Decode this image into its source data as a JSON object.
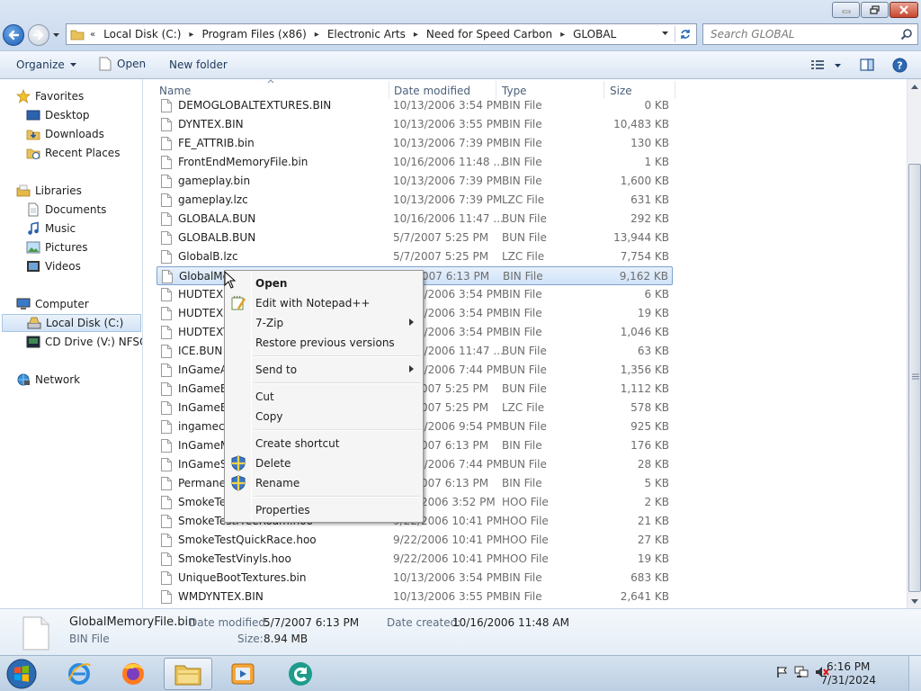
{
  "window": {
    "path": [
      "Local Disk (C:)",
      "Program Files (x86)",
      "Electronic Arts",
      "Need for Speed Carbon",
      "GLOBAL"
    ],
    "search_placeholder": "Search GLOBAL"
  },
  "toolbar": {
    "organize": "Organize",
    "open": "Open",
    "new_folder": "New folder"
  },
  "nav": {
    "favorites": "Favorites",
    "desktop": "Desktop",
    "downloads": "Downloads",
    "recent_places": "Recent Places",
    "libraries": "Libraries",
    "documents": "Documents",
    "music": "Music",
    "pictures": "Pictures",
    "videos": "Videos",
    "computer": "Computer",
    "local_disk": "Local Disk (C:)",
    "cd_drive": "CD Drive (V:) NFSCA",
    "network": "Network"
  },
  "columns": {
    "name": "Name",
    "date_modified": "Date modified",
    "type": "Type",
    "size": "Size"
  },
  "files": [
    {
      "name": "DEMOGLOBALTEXTURES.BIN",
      "date": "10/13/2006 3:54 PM",
      "type": "BIN File",
      "size": "0 KB"
    },
    {
      "name": "DYNTEX.BIN",
      "date": "10/13/2006 3:55 PM",
      "type": "BIN File",
      "size": "10,483 KB"
    },
    {
      "name": "FE_ATTRIB.bin",
      "date": "10/13/2006 7:39 PM",
      "type": "BIN File",
      "size": "130 KB"
    },
    {
      "name": "FrontEndMemoryFile.bin",
      "date": "10/16/2006 11:48 ...",
      "type": "BIN File",
      "size": "1 KB"
    },
    {
      "name": "gameplay.bin",
      "date": "10/13/2006 7:39 PM",
      "type": "BIN File",
      "size": "1,600 KB"
    },
    {
      "name": "gameplay.lzc",
      "date": "10/13/2006 7:39 PM",
      "type": "LZC File",
      "size": "631 KB"
    },
    {
      "name": "GLOBALA.BUN",
      "date": "10/16/2006 11:47 ...",
      "type": "BUN File",
      "size": "292 KB"
    },
    {
      "name": "GLOBALB.BUN",
      "date": "5/7/2007 5:25 PM",
      "type": "BUN File",
      "size": "13,944 KB"
    },
    {
      "name": "GlobalB.lzc",
      "date": "5/7/2007 5:25 PM",
      "type": "LZC File",
      "size": "7,754 KB"
    },
    {
      "name": "GlobalMe",
      "date": "5/7/2007 6:13 PM",
      "type": "BIN File",
      "size": "9,162 KB"
    },
    {
      "name": "HUDTEXF",
      "date": "10/13/2006 3:54 PM",
      "type": "BIN File",
      "size": "6 KB"
    },
    {
      "name": "HUDTEXS",
      "date": "10/13/2006 3:54 PM",
      "type": "BIN File",
      "size": "19 KB"
    },
    {
      "name": "HUDTEXT",
      "date": "10/13/2006 3:54 PM",
      "type": "BIN File",
      "size": "1,046 KB"
    },
    {
      "name": "ICE.BUN",
      "date": "10/16/2006 11:47 ...",
      "type": "BUN File",
      "size": "63 KB"
    },
    {
      "name": "InGameA",
      "date": "10/13/2006 7:44 PM",
      "type": "BUN File",
      "size": "1,356 KB"
    },
    {
      "name": "InGameB.",
      "date": "5/7/2007 5:25 PM",
      "type": "BUN File",
      "size": "1,112 KB"
    },
    {
      "name": "InGameB.",
      "date": "5/7/2007 5:25 PM",
      "type": "LZC File",
      "size": "578 KB"
    },
    {
      "name": "ingamec.",
      "date": "10/13/2006 9:54 PM",
      "type": "BUN File",
      "size": "925 KB"
    },
    {
      "name": "InGameM",
      "date": "5/7/2007 6:13 PM",
      "type": "BIN File",
      "size": "176 KB"
    },
    {
      "name": "InGameSp",
      "date": "10/13/2006 7:44 PM",
      "type": "BUN File",
      "size": "28 KB"
    },
    {
      "name": "Permaner",
      "date": "5/7/2007 6:13 PM",
      "type": "BIN File",
      "size": "5 KB"
    },
    {
      "name": "SmokeTe",
      "date": "9/22/2006 3:52 PM",
      "type": "HOO File",
      "size": "2 KB"
    },
    {
      "name": "SmokeTestFreeRoam.hoo",
      "date": "9/22/2006 10:41 PM",
      "type": "HOO File",
      "size": "21 KB"
    },
    {
      "name": "SmokeTestQuickRace.hoo",
      "date": "9/22/2006 10:41 PM",
      "type": "HOO File",
      "size": "27 KB"
    },
    {
      "name": "SmokeTestVinyls.hoo",
      "date": "9/22/2006 10:41 PM",
      "type": "HOO File",
      "size": "19 KB"
    },
    {
      "name": "UniqueBootTextures.bin",
      "date": "10/13/2006 3:54 PM",
      "type": "BIN File",
      "size": "683 KB"
    },
    {
      "name": "WMDYNTEX.BIN",
      "date": "10/13/2006 3:55 PM",
      "type": "BIN File",
      "size": "2,641 KB"
    }
  ],
  "context_menu": {
    "open": "Open",
    "edit_notepad": "Edit with Notepad++",
    "sevenzip": "7-Zip",
    "restore": "Restore previous versions",
    "send_to": "Send to",
    "cut": "Cut",
    "copy": "Copy",
    "create_shortcut": "Create shortcut",
    "delete": "Delete",
    "rename": "Rename",
    "properties": "Properties"
  },
  "details": {
    "filename": "GlobalMemoryFile.bin",
    "filetype": "BIN File",
    "date_modified_label": "Date modified:",
    "date_modified": "5/7/2007 6:13 PM",
    "date_created_label": "Date created:",
    "date_created": "10/16/2006 11:48 AM",
    "size_label": "Size:",
    "size": "8.94 MB"
  },
  "taskbar": {
    "time": "6:16 PM",
    "date": "7/31/2024"
  },
  "colors": {
    "selection": "#cfe2f8",
    "accent": "#1e395b"
  }
}
